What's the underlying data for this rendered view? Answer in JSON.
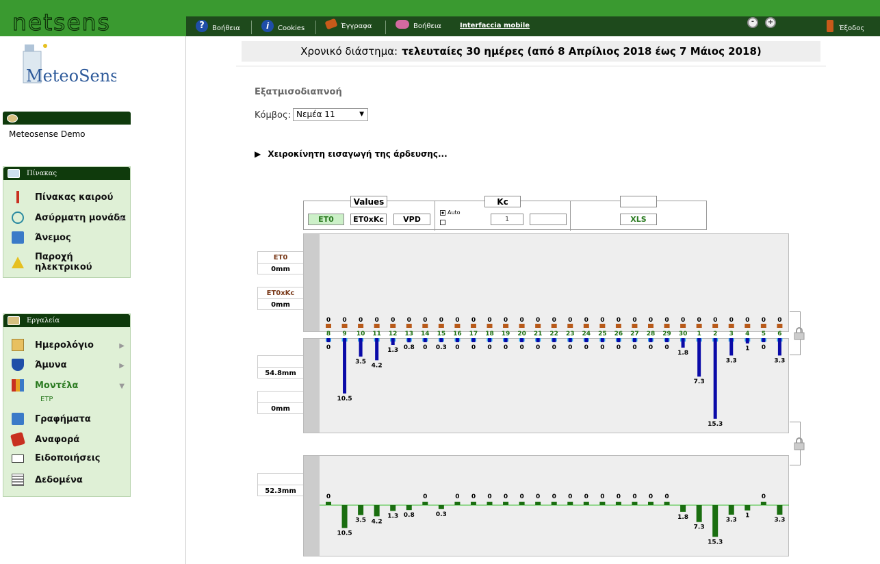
{
  "brand": {
    "name": "netsens",
    "meteo_logo": "MeteoSense"
  },
  "toolbar": {
    "items": [
      {
        "label": "Βοήθεια",
        "icon": "help-icon",
        "color": "#1f4ea8"
      },
      {
        "label": "Cookies",
        "icon": "info-icon",
        "color": "#1f4ea8"
      },
      {
        "label": "Έγγραφα",
        "icon": "book-icon",
        "color": "#c85a1a"
      },
      {
        "label": "Βοήθεια",
        "icon": "chat-icon",
        "color": "#d36aa0"
      }
    ],
    "mobile_link": "Interfaccia mobile",
    "logout": "Έξοδος"
  },
  "sidebar": {
    "account_name": "Meteosense Demo",
    "panel_board": {
      "title": "Πίνακας",
      "items": [
        {
          "label": "Πίνακας καιρού",
          "icon": "thermometer-icon"
        },
        {
          "label": "Ασύρματη μονάδα",
          "icon": "wireless-icon"
        },
        {
          "label": "Άνεμος",
          "icon": "wind-icon"
        },
        {
          "label": "Παροχή ηλεκτρικού",
          "icon": "warning-icon"
        }
      ]
    },
    "panel_tools": {
      "title": "Εργαλεία",
      "items": [
        {
          "label": "Ημερολόγιο",
          "icon": "calendar-icon"
        },
        {
          "label": "Άμυνα",
          "icon": "shield-icon"
        },
        {
          "label": "Μοντέλα",
          "icon": "models-icon"
        },
        {
          "label": "Γραφήματα",
          "icon": "chart-icon"
        },
        {
          "label": "Αναφορά",
          "icon": "report-icon"
        },
        {
          "label": "Ειδοποιήσεις",
          "icon": "mail-icon"
        },
        {
          "label": "Δεδομένα",
          "icon": "data-icon"
        }
      ],
      "submenu": "ETP"
    }
  },
  "main": {
    "period_label": "Χρονικό διάστημα:",
    "period_value": "τελευταίες 30 ημέρες (από 8 Απρίλιος 2018 έως 7 Μάιος 2018)",
    "section_title": "Εξατμισοδιαπνοή",
    "node_label": "Κόμβος:",
    "node_value": "Νεμέα 11",
    "manual_entry": "Χειροκίνητη εισαγωγή της άρδευσης...",
    "controls": {
      "values_title": "Values",
      "btn_et0": "ET0",
      "btn_et0xkc": "ET0xKc",
      "btn_vpd": "VPD",
      "kc_title": "Kc",
      "auto_label": "Auto",
      "kc_value": "1",
      "xls": "XLS"
    },
    "left_labels": {
      "et0_title": "ET0",
      "et0_value": "0mm",
      "et0xkc_title": "ET0xKc",
      "et0xkc_value": "0mm",
      "rain1_value": "54.8mm",
      "rain2_value": "0mm",
      "balance_value": "52.3mm"
    }
  },
  "chart_data": {
    "type": "bar",
    "categories": [
      "8",
      "9",
      "10",
      "11",
      "12",
      "13",
      "14",
      "15",
      "16",
      "17",
      "18",
      "19",
      "20",
      "21",
      "22",
      "23",
      "24",
      "25",
      "26",
      "27",
      "28",
      "29",
      "30",
      "1",
      "2",
      "3",
      "4",
      "5",
      "6"
    ],
    "series": [
      {
        "name": "ET0",
        "values": [
          0,
          0,
          0,
          0,
          0,
          0,
          0,
          0,
          0,
          0,
          0,
          0,
          0,
          0,
          0,
          0,
          0,
          0,
          0,
          0,
          0,
          0,
          0,
          0,
          0,
          0,
          0,
          0,
          0
        ]
      },
      {
        "values": [
          0,
          10.5,
          3.5,
          4.2,
          1.3,
          0.8,
          0,
          0.3,
          0,
          0,
          0,
          0,
          0,
          0,
          0,
          0,
          0,
          0,
          0,
          0,
          0,
          0,
          1.8,
          7.3,
          15.3,
          3.3,
          1,
          0,
          3.3
        ]
      },
      {
        "values": [
          0,
          -10.5,
          -3.5,
          -4.2,
          -1.3,
          -0.8,
          0,
          -0.3,
          0,
          0,
          0,
          0,
          0,
          0,
          0,
          0,
          0,
          0,
          0,
          0,
          0,
          0,
          -1.8,
          -7.3,
          -15.3,
          -3.3,
          -1,
          0,
          -3.3
        ]
      }
    ],
    "colors": {
      "et0": "#b85a1a",
      "rain": "#0a0aa8",
      "rain_marker": "#33aaee",
      "balance": "#1a6e10",
      "category_text": "#1a6e10"
    }
  }
}
